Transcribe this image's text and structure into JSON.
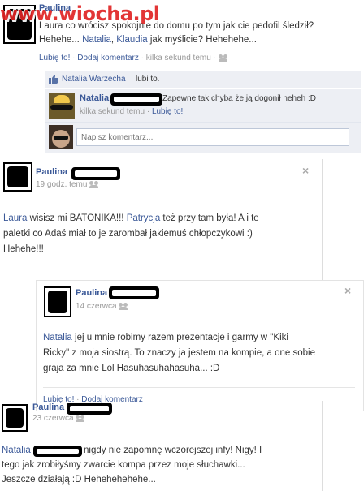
{
  "watermark": "www.wiocha.pl",
  "post1": {
    "author": "Paulina",
    "text_partial_a": "Laura co wrócisz spokojnie do domu po tym jak cie pedofil śledził?",
    "text_b_prefix": "Hehehe... ",
    "mention_natalia": "Natalia",
    "comma": ", ",
    "mention_klaudia": "Klaudia",
    "text_b_suffix": " jak myślicie? Hehehehe...",
    "actions": {
      "like": "Lubię to!",
      "sep1": " · ",
      "comment": "Dodaj komentarz",
      "sep2": " · ",
      "time": "kilka sekund temu",
      "sep3": " · "
    },
    "likes": {
      "name": "Natalia Warzecha",
      "suffix": " lubi to."
    },
    "comment": {
      "author": "Natalia",
      "text": "Zapewne tak chyba że ją dogonił heheh :D",
      "time": "kilka sekund temu",
      "sep": " · ",
      "like": "Lubię to!"
    },
    "comment_input_placeholder": "Napisz komentarz..."
  },
  "post2": {
    "author": "Paulina",
    "time": "19 godz. temu",
    "close": "×",
    "line1_mention_a": "Laura",
    "line1_mid": " wisisz mi BATONIKA!!! ",
    "line1_mention_b": "Patrycja",
    "line1_end": " też przy tam była! A i te",
    "line2": "paletki co Adaś miał to je zarombał jakiemuś chłopczykowi :)",
    "line3": "Hehehe!!!"
  },
  "post3": {
    "author": "Paulina",
    "time": "14 czerwca",
    "close": "×",
    "line1_mention": "Natalia",
    "line1_rest": " jej u mnie robimy razem prezentacje i garmy w \"Kiki",
    "line2": "Ricky\" z moja siostrą. To znaczy ja jestem na kompie, a one sobie",
    "line3": "graja za mnie Lol Hasuhasuhahasuha... :D",
    "actions": {
      "like": "Lubię to!",
      "sep": " · ",
      "comment": "Dodaj komentarz"
    }
  },
  "post4": {
    "author": "Paulina",
    "time": "23 czerwca",
    "line1_mention": "Natalia",
    "line1_rest": "nigdy nie zapomnę wczorejszej infy! Nigy! I",
    "line2": "tego jak zrobiłyśmy zwarcie kompa przez moje słuchawki...",
    "line3": "Jeszcze działają :D Hehehehehehe..."
  },
  "colors": {
    "link": "#3b5998",
    "muted": "#999999",
    "comment_bg": "#edeff4"
  }
}
